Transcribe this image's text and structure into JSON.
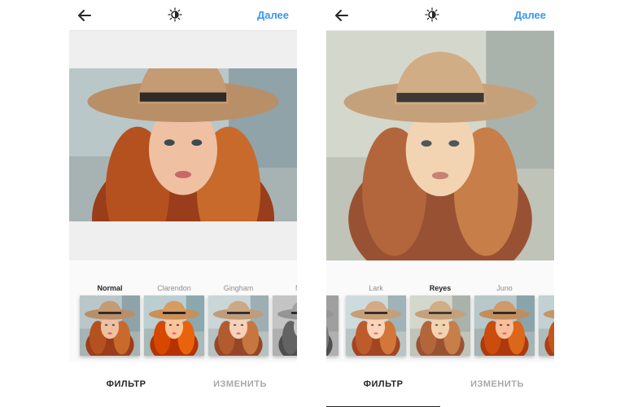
{
  "colors": {
    "accent": "#3897f0",
    "text_active": "#262626",
    "text_inactive": "#a8a8a8"
  },
  "icons": {
    "back": "arrow-left-icon",
    "lux": "lux-adjust-icon"
  },
  "screens": [
    {
      "header": {
        "next_label": "Далее"
      },
      "filters": [
        {
          "name": "Normal",
          "active": true
        },
        {
          "name": "Clarendon",
          "active": false
        },
        {
          "name": "Gingham",
          "active": false
        },
        {
          "name": "M",
          "active": false
        }
      ],
      "tabs": {
        "filter_label": "ФИЛЬТР",
        "edit_label": "ИЗМЕНИТЬ"
      }
    },
    {
      "header": {
        "next_label": "Далее"
      },
      "filters": [
        {
          "name": "",
          "active": false
        },
        {
          "name": "Lark",
          "active": false
        },
        {
          "name": "Reyes",
          "active": true
        },
        {
          "name": "Juno",
          "active": false
        },
        {
          "name": "",
          "active": false
        }
      ],
      "tabs": {
        "filter_label": "ФИЛЬТР",
        "edit_label": "ИЗМЕНИТЬ"
      }
    }
  ]
}
